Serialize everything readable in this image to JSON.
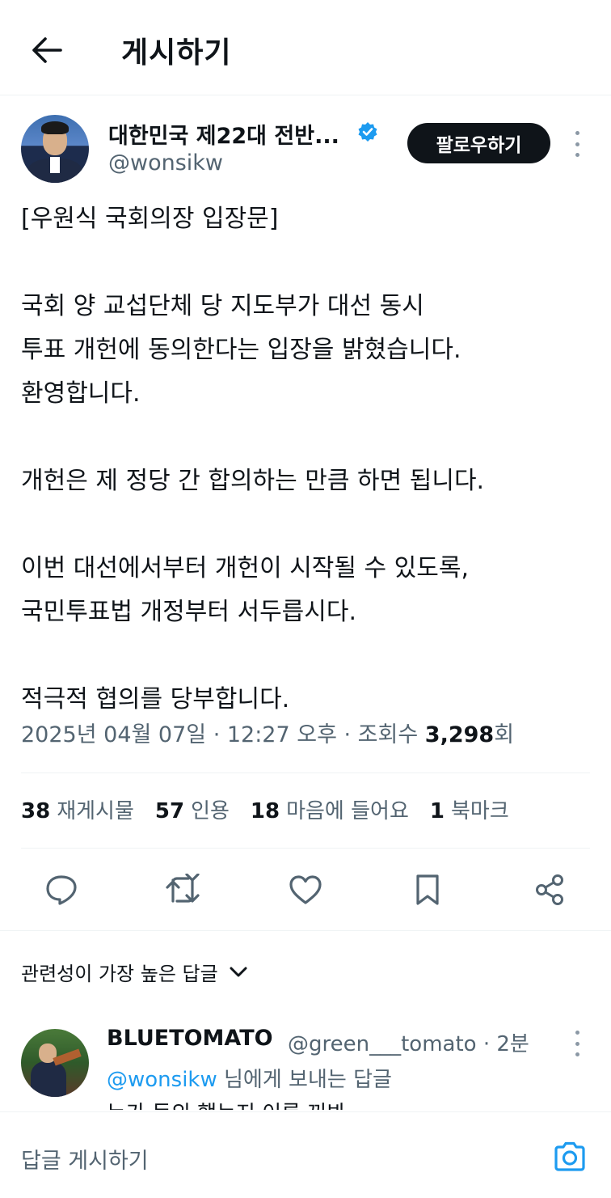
{
  "header": {
    "title": "게시하기"
  },
  "author": {
    "name": "대한민국 제22대 전반...",
    "handle": "@wonsikw",
    "follow_label": "팔로우하기"
  },
  "tweet": {
    "text": "[우원식 국회의장 입장문]\n\n국회 양 교섭단체 당 지도부가 대선 동시\n투표 개헌에 동의한다는 입장을 밝혔습니다.\n환영합니다.\n\n개헌은 제 정당 간 합의하는 만큼 하면 됩니다.\n\n이번 대선에서부터 개헌이 시작될 수 있도록,\n국민투표법 개정부터 서두릅시다.\n\n적극적 협의를 당부합니다.",
    "meta_prefix": "2025년 04월 07일 · 12:27 오후 · 조회수 ",
    "views": "3,298",
    "views_suffix": "회"
  },
  "stats": {
    "retweets_count": "38",
    "retweets_label": "재게시물",
    "quotes_count": "57",
    "quotes_label": "인용",
    "likes_count": "18",
    "likes_label": "마음에 들어요",
    "bookmarks_count": "1",
    "bookmarks_label": "북마크"
  },
  "actions": {
    "icons": [
      "reply-icon",
      "retweet-icon",
      "like-icon",
      "bookmark-icon",
      "share-icon"
    ]
  },
  "replies": {
    "sort_label": "관련성이 가장 높은 답글",
    "items": [
      {
        "name": "BLUETOMATO",
        "handle_time": "@green___tomato · 2분",
        "reply_to_mention": "@wonsikw",
        "reply_to_suffix": " 님에게 보내는 답글",
        "text": "누가 동의 했는지 이름 꺼봐"
      }
    ]
  },
  "composer": {
    "placeholder": "답글 게시하기"
  },
  "colors": {
    "accent": "#1d9bf0",
    "text": "#0f1419",
    "muted": "#536471"
  }
}
